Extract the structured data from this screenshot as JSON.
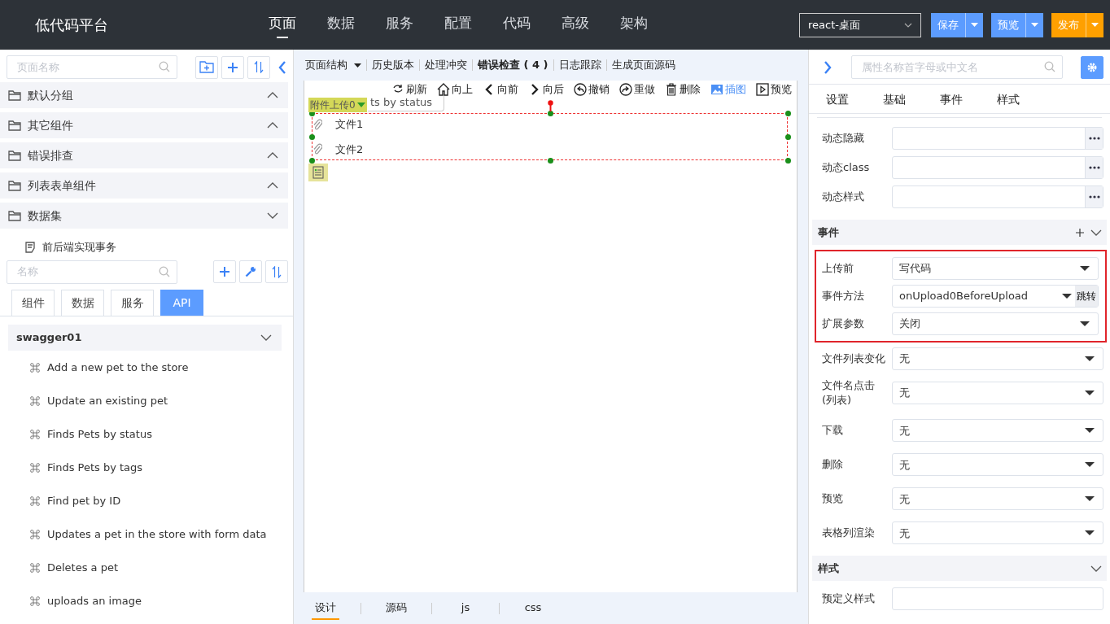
{
  "header": {
    "logo": "低代码平台",
    "nav": [
      {
        "label": "页面",
        "selected": true
      },
      {
        "label": "数据",
        "selected": false
      },
      {
        "label": "服务",
        "selected": false
      },
      {
        "label": "配置",
        "selected": false
      },
      {
        "label": "代码",
        "selected": false
      },
      {
        "label": "高级",
        "selected": false
      },
      {
        "label": "架构",
        "selected": false
      }
    ],
    "env_select": "react-桌面",
    "buttons": [
      {
        "label": "保存",
        "kind": "primary"
      },
      {
        "label": "预览",
        "kind": "primary"
      },
      {
        "label": "发布",
        "kind": "warning"
      }
    ]
  },
  "left_panel": {
    "search": {
      "placeholder": "页面名称"
    },
    "groups": [
      {
        "label": "默认分组",
        "expanded": false
      },
      {
        "label": "其它组件",
        "expanded": false
      },
      {
        "label": "错误排查",
        "expanded": false
      },
      {
        "label": "列表表单组件",
        "expanded": false
      },
      {
        "label": "数据集",
        "expanded": true
      }
    ],
    "datasets": [
      {
        "label": "前后端实现事务"
      }
    ],
    "api_search": {
      "placeholder": "名称"
    },
    "tabs": [
      {
        "label": "组件",
        "selected": false
      },
      {
        "label": "数据",
        "selected": false
      },
      {
        "label": "服务",
        "selected": false
      },
      {
        "label": "API",
        "selected": true
      }
    ],
    "api_group": {
      "label": "swagger01",
      "expanded": true,
      "items": [
        "Add a new pet to the store",
        "Update an existing pet",
        "Finds Pets by status",
        "Finds Pets by tags",
        "Find pet by ID",
        "Updates a pet in the store with form data",
        "Deletes a pet",
        "uploads an image"
      ]
    }
  },
  "editor": {
    "toolbar": [
      {
        "label": "页面结构",
        "kind": "dropdown"
      },
      {
        "label": "历史版本",
        "kind": "link"
      },
      {
        "label": "处理冲突",
        "kind": "link"
      },
      {
        "label": "错误检查 ( 4 )",
        "kind": "error"
      },
      {
        "label": "日志跟踪",
        "kind": "link"
      },
      {
        "label": "生成页面源码",
        "kind": "link"
      }
    ],
    "actions": [
      {
        "label": "刷新",
        "kind": "refresh",
        "selected": false
      },
      {
        "label": "向上",
        "kind": "home",
        "selected": false
      },
      {
        "label": "向前",
        "kind": "back",
        "selected": false
      },
      {
        "label": "向后",
        "kind": "forward",
        "selected": false
      },
      {
        "label": "撤销",
        "kind": "undo",
        "selected": false
      },
      {
        "label": "重做",
        "kind": "redo",
        "selected": false
      },
      {
        "label": "删除",
        "kind": "delete",
        "selected": false
      },
      {
        "label": "插图",
        "kind": "image",
        "selected": true
      },
      {
        "label": "预览",
        "kind": "preview",
        "selected": false
      }
    ],
    "ghost_button": "ts by status",
    "component_tag": "附件上传0",
    "files": [
      "文件1",
      "文件2"
    ],
    "bottom_tabs": [
      {
        "label": "设计",
        "selected": true
      },
      {
        "label": "源码",
        "selected": false
      },
      {
        "label": "js",
        "selected": false
      },
      {
        "label": "css",
        "selected": false
      }
    ]
  },
  "right_panel": {
    "search": {
      "placeholder": "属性名称首字母或中文名"
    },
    "tabs": [
      {
        "label": "设置",
        "selected": false
      },
      {
        "label": "基础",
        "selected": false
      },
      {
        "label": "事件",
        "selected": false
      },
      {
        "label": "样式",
        "selected": false
      }
    ],
    "props": [
      {
        "label": "动态隐藏",
        "kind": "expr"
      },
      {
        "label": "动态class",
        "kind": "expr"
      },
      {
        "label": "动态样式",
        "kind": "expr"
      }
    ],
    "events": {
      "title": "事件",
      "expanded": true,
      "highlighted": [
        {
          "label": "上传前",
          "value": "写代码",
          "kind": "select"
        },
        {
          "label": "事件方法",
          "value": "onUpload0BeforeUpload",
          "kind": "jump",
          "button": "跳转"
        },
        {
          "label": "扩展参数",
          "value": "关闭",
          "kind": "select"
        }
      ],
      "rows": [
        {
          "label": "文件列表变化",
          "value": "无",
          "kind": "select"
        },
        {
          "label": "文件名点击(列表)",
          "value": "无",
          "kind": "select"
        },
        {
          "label": "下载",
          "value": "无",
          "kind": "select"
        },
        {
          "label": "删除",
          "value": "无",
          "kind": "select"
        },
        {
          "label": "预览",
          "value": "无",
          "kind": "select"
        },
        {
          "label": "表格列渲染",
          "value": "无",
          "kind": "select"
        }
      ]
    },
    "style": {
      "title": "样式",
      "expanded": true,
      "rows": [
        {
          "label": "预定义样式",
          "kind": "text"
        }
      ]
    }
  }
}
